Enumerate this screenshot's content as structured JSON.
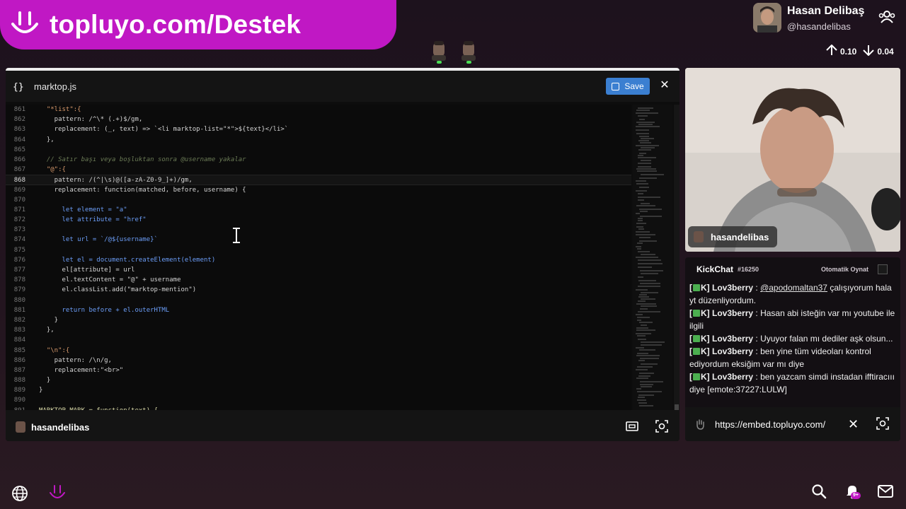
{
  "banner": {
    "text": "topluyo.com/Destek",
    "logo_icon": "smile-logo-icon",
    "color": "#c018c4"
  },
  "profile": {
    "name": "Hasan Delibaş",
    "handle": "@hasandelibas",
    "icon": "users-icon"
  },
  "rates": {
    "up": "0.10",
    "down": "0.04"
  },
  "editor": {
    "filename": "marktop.js",
    "save_label": "Save",
    "footer_user": "hasandelibas",
    "lines": [
      {
        "n": "861",
        "t": "  \"*list\":{"
      },
      {
        "n": "862",
        "t": "    pattern: /^\\* (.+)$/gm,"
      },
      {
        "n": "863",
        "t": "    replacement: (_, text) => `<li marktop-list=\"*\">${text}</li>`"
      },
      {
        "n": "864",
        "t": "  },"
      },
      {
        "n": "865",
        "t": ""
      },
      {
        "n": "866",
        "t": "  // Satır başı veya boşluktan sonra @username yakalar"
      },
      {
        "n": "867",
        "t": "  \"@\":{"
      },
      {
        "n": "868",
        "t": "    pattern: /(^|\\s)@([a-zA-Z0-9_]+)/gm,"
      },
      {
        "n": "869",
        "t": "    replacement: function(matched, before, username) {"
      },
      {
        "n": "870",
        "t": ""
      },
      {
        "n": "871",
        "t": "      let element = \"a\""
      },
      {
        "n": "872",
        "t": "      let attribute = \"href\""
      },
      {
        "n": "873",
        "t": ""
      },
      {
        "n": "874",
        "t": "      let url = `/@${username}`"
      },
      {
        "n": "875",
        "t": ""
      },
      {
        "n": "876",
        "t": "      let el = document.createElement(element)"
      },
      {
        "n": "877",
        "t": "      el[attribute] = url"
      },
      {
        "n": "878",
        "t": "      el.textContent = \"@\" + username"
      },
      {
        "n": "879",
        "t": "      el.classList.add(\"marktop-mention\")"
      },
      {
        "n": "880",
        "t": ""
      },
      {
        "n": "881",
        "t": "      return before + el.outerHTML"
      },
      {
        "n": "882",
        "t": "    }"
      },
      {
        "n": "883",
        "t": "  },"
      },
      {
        "n": "884",
        "t": ""
      },
      {
        "n": "885",
        "t": "  \"\\n\":{"
      },
      {
        "n": "886",
        "t": "    pattern: /\\n/g,"
      },
      {
        "n": "887",
        "t": "    replacement:\"<br>\""
      },
      {
        "n": "888",
        "t": "  }"
      },
      {
        "n": "889",
        "t": "}"
      },
      {
        "n": "890",
        "t": ""
      },
      {
        "n": "891",
        "t": "MARKTOP.MARK = function(text) {"
      }
    ],
    "active_line": "868"
  },
  "cam": {
    "label": "hasandelibas"
  },
  "chat": {
    "title": "KickChat",
    "count": "#16250",
    "auto_play": "Otomatik Oynat",
    "url": "https://embed.topluyo.com/",
    "messages": [
      {
        "prefix": "[",
        "suffix": "K]",
        "user": "Lov3berry",
        "mention": "@apodomaltan37",
        "text": " çalışıyorum hala yt düzenliyordum."
      },
      {
        "prefix": "[",
        "suffix": "K]",
        "user": "Lov3berry",
        "mention": "",
        "text": "Hasan abi isteğin var mı youtube ile ilgili"
      },
      {
        "prefix": "[",
        "suffix": "K]",
        "user": "Lov3berry",
        "mention": "",
        "text": "Uyuyor falan mı dediler aşk olsun..."
      },
      {
        "prefix": "[",
        "suffix": "K]",
        "user": "Lov3berry",
        "mention": "",
        "text": "ben yine tüm videoları kontrol ediyordum eksiğim var mı diye"
      },
      {
        "prefix": "[",
        "suffix": "K]",
        "user": "Lov3berry",
        "mention": "",
        "text": "ben yazcam simdi instadan ifftiracııı diye [emote:37227:LULW]"
      }
    ]
  },
  "bottom": {
    "bell_badge": "9+"
  }
}
